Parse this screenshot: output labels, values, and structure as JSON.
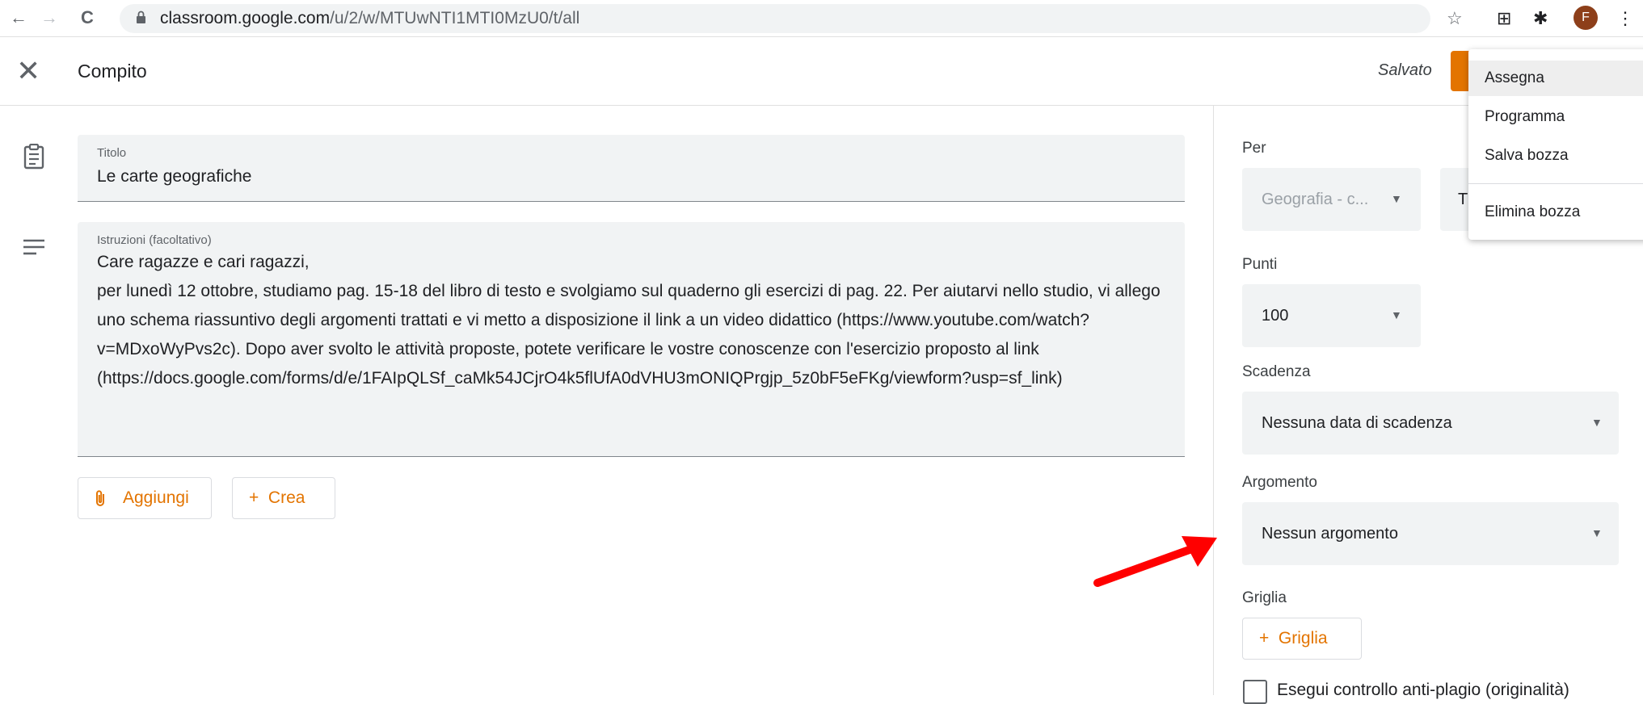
{
  "browser": {
    "back_icon": "←",
    "forward_icon": "→",
    "reload_icon": "C",
    "url_host": "classroom.google.com",
    "url_path": "/u/2/w/MTUwNTI1MTI0MzU0/t/all",
    "bookmark_icon": "☆",
    "grid_icon": "⊞",
    "extensions_icon": "✱",
    "avatar_letter": "F",
    "menu_icon": "⋮"
  },
  "header": {
    "close_icon": "✕",
    "title": "Compito",
    "status": "Salvato"
  },
  "form": {
    "title_label": "Titolo",
    "title_value": "Le carte geografiche",
    "instructions_label": "Istruzioni (facoltativo)",
    "instructions_value": "Care ragazze e cari ragazzi,\nper lunedì 12 ottobre, studiamo pag. 15-18 del libro di testo e svolgiamo sul quaderno gli esercizi di pag. 22. Per aiutarvi nello studio, vi allego uno schema riassuntivo degli argomenti trattati e vi metto a disposizione il link a un video didattico (https://www.youtube.com/watch?v=MDxoWyPvs2c). Dopo aver svolto le attività proposte, potete verificare le vostre conoscenze con l'esercizio proposto al link\n(https://docs.google.com/forms/d/e/1FAIpQLSf_caMk54JCjrO4k5flUfA0dVHU3mONIQPrgjp_5z0bF5eFKg/viewform?usp=sf_link)",
    "attach_label": "Aggiungi",
    "create_label": "+  Crea"
  },
  "panel": {
    "for_label": "Per",
    "class_value": "Geografia - c...",
    "students_value_partial": "T",
    "points_label": "Punti",
    "points_value": "100",
    "due_label": "Scadenza",
    "due_value": "Nessuna data di scadenza",
    "topic_label": "Argomento",
    "topic_value": "Nessun argomento",
    "rubric_label": "Griglia",
    "rubric_button": "+  Griglia",
    "originality_label": "Esegui controllo anti-plagio (originalità)"
  },
  "menu": {
    "items": [
      "Assegna",
      "Programma",
      "Salva bozza",
      "Elimina bozza"
    ]
  },
  "colors": {
    "accent": "#e37400",
    "arrow": "#ff0000"
  }
}
